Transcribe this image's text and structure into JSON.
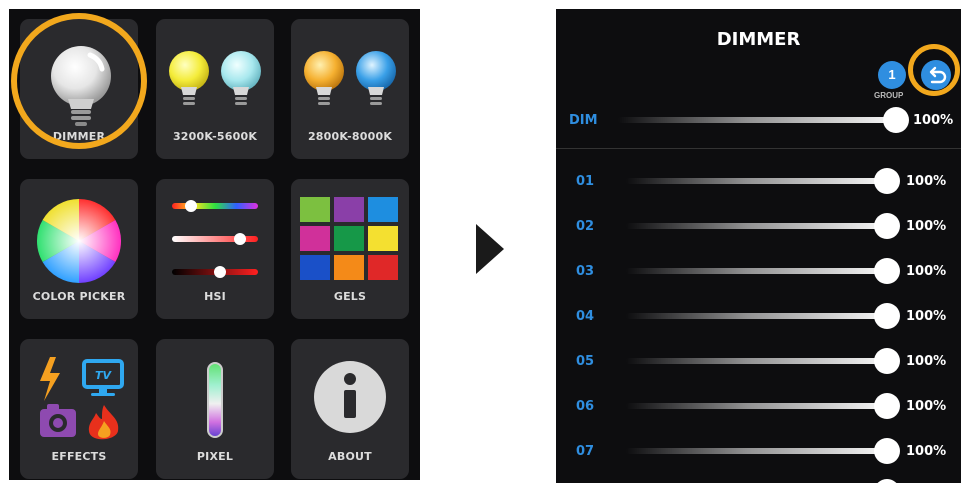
{
  "menu": {
    "tiles": [
      {
        "label": "DIMMER",
        "icon": "dimmer-bulb-icon"
      },
      {
        "label": "3200K-5600K",
        "icon": "bicolor-bulbs-icon"
      },
      {
        "label": "2800K-8000K",
        "icon": "wide-cct-bulbs-icon"
      },
      {
        "label": "COLOR PICKER",
        "icon": "color-wheel-icon"
      },
      {
        "label": "HSI",
        "icon": "hsi-sliders-icon"
      },
      {
        "label": "GELS",
        "icon": "gels-grid-icon"
      },
      {
        "label": "EFFECTS",
        "icon": "effects-icons"
      },
      {
        "label": "PIXEL",
        "icon": "pixel-tube-icon"
      },
      {
        "label": "ABOUT",
        "icon": "info-icon"
      }
    ],
    "selected": "DIMMER"
  },
  "dimmer": {
    "title": "DIMMER",
    "group_number": "1",
    "group_label": "GROUP",
    "master": {
      "label": "DIM",
      "value": "100%"
    },
    "channels": [
      {
        "label": "01",
        "value": "100%"
      },
      {
        "label": "02",
        "value": "100%"
      },
      {
        "label": "03",
        "value": "100%"
      },
      {
        "label": "04",
        "value": "100%"
      },
      {
        "label": "05",
        "value": "100%"
      },
      {
        "label": "06",
        "value": "100%"
      },
      {
        "label": "07",
        "value": "100%"
      }
    ]
  },
  "colors": {
    "accent_blue": "#2f8ee0",
    "highlight_orange": "#f2a81d",
    "panel_bg": "#0d0d0f",
    "tile_bg": "#2a2a2d"
  }
}
